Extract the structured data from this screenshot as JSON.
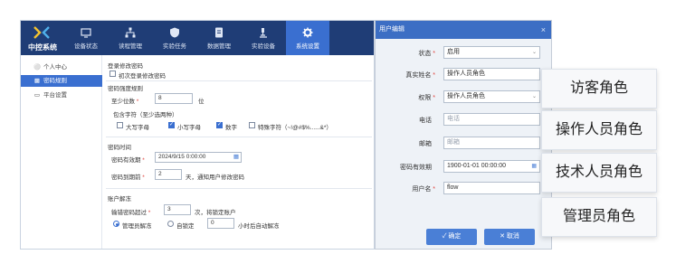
{
  "app": {
    "title": "中控系统",
    "brand_color": "#1f3d76",
    "accent_color": "#3a6fd0"
  },
  "topnav": {
    "items": [
      {
        "label": "设备状态",
        "icon": "monitor-icon"
      },
      {
        "label": "读程管理",
        "icon": "network-icon"
      },
      {
        "label": "实验任务",
        "icon": "shield-icon"
      },
      {
        "label": "数据管理",
        "icon": "document-icon"
      },
      {
        "label": "实验设备",
        "icon": "microscope-icon"
      },
      {
        "label": "系统设置",
        "icon": "gear-icon",
        "active": true
      }
    ]
  },
  "sidebar": {
    "items": [
      {
        "label": "个人中心",
        "icon": "user-icon"
      },
      {
        "label": "密码规则",
        "icon": "lock-icon",
        "active": true
      },
      {
        "label": "平台设置",
        "icon": "screen-icon"
      }
    ]
  },
  "settings": {
    "login_pwd": {
      "title": "登录修改密码",
      "first_login_label": "初次登录修改密码",
      "first_login_checked": false
    },
    "strength": {
      "title": "密码强度规则",
      "min_len_label": "至少位数",
      "min_len_value": "8",
      "min_len_unit": "位",
      "contains_label": "包含字符（至少选两种）",
      "options": [
        {
          "label": "大写字母",
          "checked": false
        },
        {
          "label": "小写字母",
          "checked": true
        },
        {
          "label": "数字",
          "checked": true
        },
        {
          "label": "特殊字符（~!@#$%......&*）",
          "checked": false
        }
      ]
    },
    "time": {
      "title": "密码时间",
      "expiry_label": "密码有效期",
      "expiry_value": "2024/9/15 0:00:00",
      "notice_label": "密码到期前",
      "notice_value": "2",
      "notice_suffix": "天，通知用户修改密码"
    },
    "lock": {
      "title": "账户解冻",
      "retry_label": "输错密码超过",
      "retry_value": "3",
      "retry_suffix": "次，将锁定账户",
      "admin_unlock_label": "管理员解冻",
      "auto_unlock_label": "自锁定",
      "auto_unlock_value": "0",
      "auto_unlock_suffix": "小时后自动解冻",
      "selected": "admin"
    }
  },
  "dialog": {
    "title": "用户编辑",
    "close_symbol": "×",
    "fields": {
      "status": {
        "label": "状态",
        "value": "启用"
      },
      "realname": {
        "label": "真实姓名",
        "value": "操作人员角色"
      },
      "permission": {
        "label": "权限",
        "value": "操作人员角色"
      },
      "phone": {
        "label": "电话",
        "placeholder": "电话"
      },
      "email": {
        "label": "邮箱",
        "placeholder": "邮箱"
      },
      "pwd_expiry": {
        "label": "密码有效期",
        "value": "1900-01-01 00:00:00"
      },
      "username": {
        "label": "用户名",
        "value": "flow"
      }
    },
    "ok_label": "确定",
    "cancel_label": "取消"
  },
  "roles": [
    "访客角色",
    "操作人员角色",
    "技术人员角色",
    "管理员角色"
  ]
}
